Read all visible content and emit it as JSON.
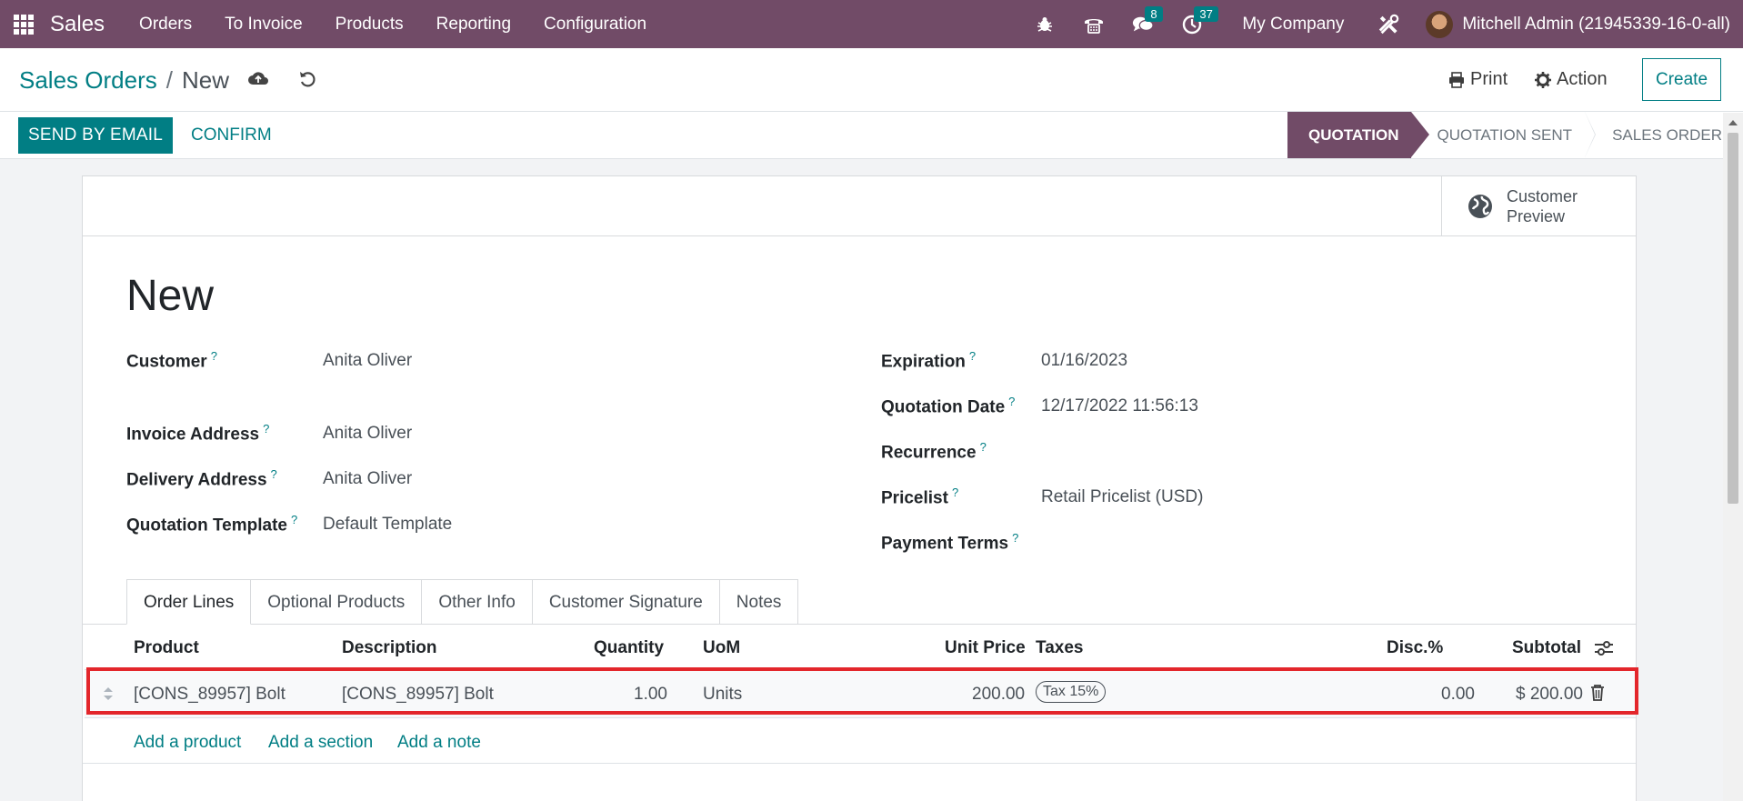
{
  "navbar": {
    "app_name": "Sales",
    "menu": [
      "Orders",
      "To Invoice",
      "Products",
      "Reporting",
      "Configuration"
    ],
    "messages_count": "8",
    "activities_count": "37",
    "company": "My Company",
    "user": "Mitchell Admin (21945339-16-0-all)"
  },
  "control": {
    "breadcrumb_parent": "Sales Orders",
    "breadcrumb_sep": "/",
    "breadcrumb_current": "New",
    "print_label": "Print",
    "action_label": "Action",
    "create_label": "Create"
  },
  "status": {
    "send_email_label": "SEND BY EMAIL",
    "confirm_label": "CONFIRM",
    "stages": [
      "QUOTATION",
      "QUOTATION SENT",
      "SALES ORDER"
    ],
    "active_stage": "QUOTATION"
  },
  "sheet": {
    "customer_preview_line1": "Customer",
    "customer_preview_line2": "Preview",
    "title": "New",
    "help_mark": "?",
    "left_fields": [
      {
        "label": "Customer",
        "value": "Anita Oliver"
      },
      {
        "label": "Invoice Address",
        "value": "Anita Oliver"
      },
      {
        "label": "Delivery Address",
        "value": "Anita Oliver"
      },
      {
        "label": "Quotation Template",
        "value": "Default Template"
      }
    ],
    "right_fields": [
      {
        "label": "Expiration",
        "value": "01/16/2023"
      },
      {
        "label": "Quotation Date",
        "value": "12/17/2022 11:56:13"
      },
      {
        "label": "Recurrence",
        "value": ""
      },
      {
        "label": "Pricelist",
        "value": "Retail Pricelist (USD)"
      },
      {
        "label": "Payment Terms",
        "value": ""
      }
    ],
    "tabs": [
      "Order Lines",
      "Optional Products",
      "Other Info",
      "Customer Signature",
      "Notes"
    ]
  },
  "order_lines": {
    "headers": {
      "product": "Product",
      "description": "Description",
      "quantity": "Quantity",
      "uom": "UoM",
      "unit_price": "Unit Price",
      "taxes": "Taxes",
      "discount": "Disc.%",
      "subtotal": "Subtotal"
    },
    "rows": [
      {
        "product": "[CONS_89957] Bolt",
        "description": "[CONS_89957] Bolt",
        "quantity": "1.00",
        "uom": "Units",
        "unit_price": "200.00",
        "tax": "Tax 15%",
        "discount": "0.00",
        "subtotal": "$ 200.00"
      }
    ],
    "add_product": "Add a product",
    "add_section": "Add a section",
    "add_note": "Add a note"
  },
  "colors": {
    "brand": "#714B67",
    "accent": "#017e84",
    "highlight": "#e3262b"
  }
}
